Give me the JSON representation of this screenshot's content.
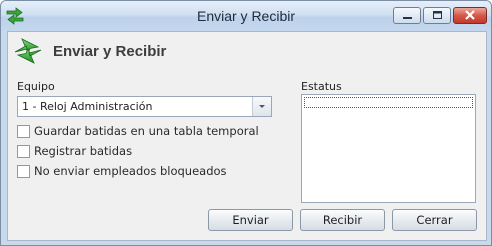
{
  "window": {
    "title": "Enviar y Recibir",
    "controls": {
      "minimize": "minimize",
      "maximize": "maximize",
      "close": "close"
    }
  },
  "header": {
    "title": "Enviar y Recibir",
    "icon": "send-receive-arrows-icon"
  },
  "form": {
    "equipo_label": "Equipo",
    "equipo_value": "1 - Reloj Administración",
    "checkboxes": [
      {
        "label": "Guardar batidas en una tabla temporal",
        "checked": false
      },
      {
        "label": "Registrar batidas",
        "checked": false
      },
      {
        "label": "No enviar empleados bloqueados",
        "checked": false
      }
    ],
    "status_label": "Estatus"
  },
  "buttons": {
    "send": "Enviar",
    "receive": "Recibir",
    "close": "Cerrar"
  },
  "colors": {
    "arrow_green": "#2f9e2f",
    "close_red": "#c2392a",
    "frame": "#c9d9ec"
  }
}
